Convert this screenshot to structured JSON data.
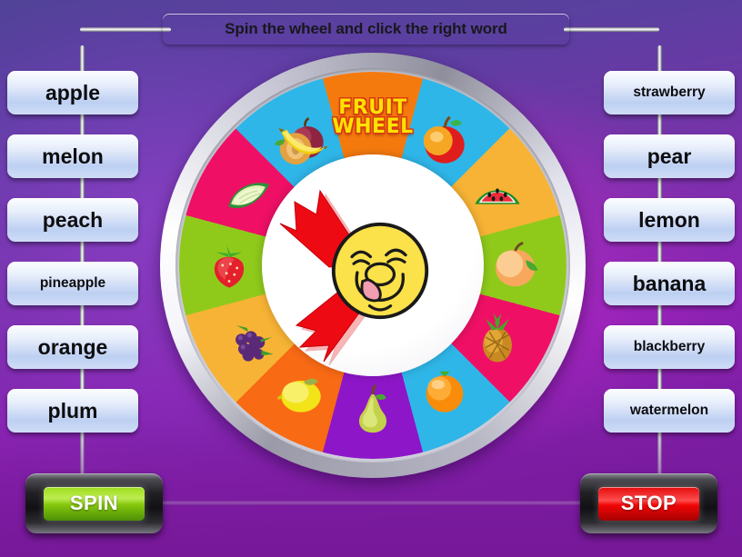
{
  "title": {
    "text": "Spin the wheel and click the right word"
  },
  "wheel": {
    "logo_line1": "FRUIT",
    "logo_line2": "WHEEL",
    "center_icon": "smiley-face-licking-lips",
    "arrow_icons": [
      "red-arrow-up-left",
      "red-arrow-down-left"
    ],
    "segments": [
      {
        "fruit": "logo",
        "color": "#f57a0e"
      },
      {
        "fruit": "apple",
        "color": "#2fb6e8"
      },
      {
        "fruit": "watermelon",
        "color": "#f7b335"
      },
      {
        "fruit": "peach",
        "color": "#8fca1b"
      },
      {
        "fruit": "pineapple",
        "color": "#ef1066"
      },
      {
        "fruit": "orange",
        "color": "#2fb6e8"
      },
      {
        "fruit": "pear",
        "color": "#8e16c9"
      },
      {
        "fruit": "lemon",
        "color": "#f86a14"
      },
      {
        "fruit": "blackberry",
        "color": "#f7b335"
      },
      {
        "fruit": "strawberry",
        "color": "#8fca1b"
      },
      {
        "fruit": "melon",
        "color": "#ef1066"
      },
      {
        "fruit": "plum",
        "color": "#2fb6e8"
      },
      {
        "fruit": "banana",
        "color": "#8e16c9"
      }
    ]
  },
  "left_words": [
    {
      "label": "apple",
      "size": "sz-l"
    },
    {
      "label": "melon",
      "size": "sz-l"
    },
    {
      "label": "peach",
      "size": "sz-l"
    },
    {
      "label": "pineapple",
      "size": "sz-s"
    },
    {
      "label": "orange",
      "size": "sz-l"
    },
    {
      "label": "plum",
      "size": "sz-l"
    }
  ],
  "right_words": [
    {
      "label": "strawberry",
      "size": "sz-s"
    },
    {
      "label": "pear",
      "size": "sz-l"
    },
    {
      "label": "lemon",
      "size": "sz-l"
    },
    {
      "label": "banana",
      "size": "sz-l"
    },
    {
      "label": "blackberry",
      "size": "sz-s"
    },
    {
      "label": "watermelon",
      "size": "sz-s"
    }
  ],
  "controls": {
    "spin_label": "SPIN",
    "stop_label": "STOP",
    "spin_color": "#86c90d",
    "stop_color": "#e20b0b"
  }
}
